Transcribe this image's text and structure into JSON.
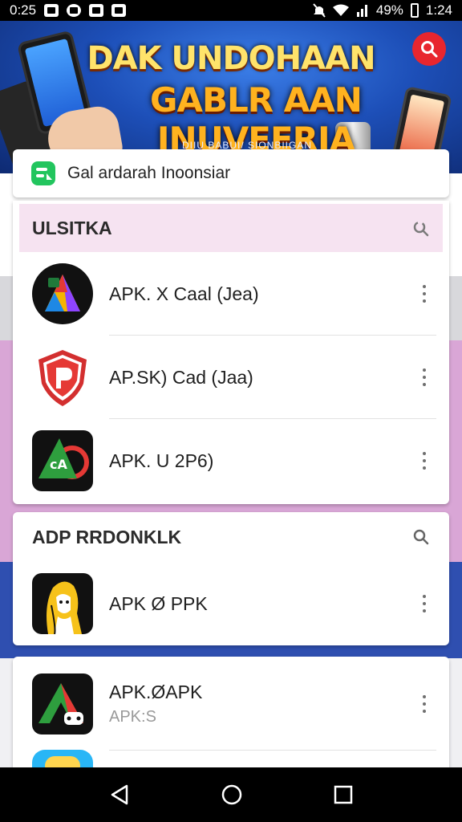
{
  "status_bar": {
    "time": "0:25",
    "battery": "49%",
    "clock_right": "1:24",
    "left_icons": [
      "photo-icon",
      "navigation-icon",
      "image-icon",
      "notification-icon"
    ],
    "right_icons": [
      "mute-icon",
      "wifi-icon",
      "signal-icon"
    ]
  },
  "banner": {
    "title_line1": "DAK UNDOHAAN",
    "title_line2": "GABLR AAN INUVEERIA",
    "subtitle": "DIIU BABUI/ SIONBIIGAN"
  },
  "search_bar": {
    "text": "Gal ardarah Inoonsiar",
    "icon": "app-logo-icon"
  },
  "section1": {
    "title": "ULSITKA",
    "header_color": "#f6e3f1",
    "items": [
      {
        "title": "APK. X Caal (Jea)",
        "icon": "multicolor-a-icon"
      },
      {
        "title": "AP.SK) Cad (Jaa)",
        "icon": "red-shield-icon"
      },
      {
        "title": "APK. U 2P6)",
        "icon": "green-a-icon"
      }
    ]
  },
  "section2": {
    "title": "ADP RRDONKLK",
    "items": [
      {
        "title": "APK Ø PPK",
        "icon": "yellow-figure-icon"
      }
    ]
  },
  "section3": {
    "items": [
      {
        "title": "APK.ØAPK",
        "subtitle": "APK:S",
        "icon": "triangle-game-icon"
      }
    ]
  },
  "nav": {
    "back": "back-icon",
    "home": "home-icon",
    "recents": "recents-icon"
  }
}
